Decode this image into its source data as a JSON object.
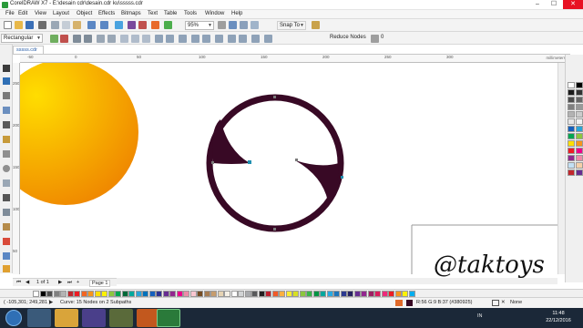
{
  "window": {
    "title": "CorelDRAW X7 - E:\\desain cdr\\desain.cdr ku\\sssss.cdr"
  },
  "menu": [
    "File",
    "Edit",
    "View",
    "Layout",
    "Object",
    "Effects",
    "Bitmaps",
    "Text",
    "Table",
    "Tools",
    "Window",
    "Help"
  ],
  "toolbar": {
    "zoom": "95%",
    "snap_to": "Snap To"
  },
  "property_bar": {
    "selection_mode": "Rectangular",
    "reduce_nodes": "Reduce Nodes",
    "smoothness_value": "0"
  },
  "document": {
    "tab": "sssss.cdr",
    "ruler_units": "millimeters"
  },
  "ruler_h": [
    "-50",
    "0",
    "50",
    "100",
    "150",
    "200",
    "250",
    "300"
  ],
  "ruler_v": [
    "250",
    "200",
    "150",
    "100",
    "50"
  ],
  "pages": {
    "position": "1 of 1",
    "page_tab": "Page 1"
  },
  "status": {
    "coords": "( -105,301; 249,281 )",
    "selection": "Curve: 15 Nodes on 2 Subpaths",
    "fill_info": "R:56 G:9 B:37 (#380925)",
    "outline": "None"
  },
  "taskbar": {
    "lang": "IN",
    "time": "11:48",
    "date": "22/12/2016"
  },
  "watermark": "@taktoys",
  "colors": {
    "shape_fill": "#380925",
    "sphere_inner": "#ffdd00",
    "sphere_outer": "#f08a00",
    "node": "#1f8fb0"
  },
  "palette_right": [
    "#ffffff",
    "#000000",
    "#1a1a1a",
    "#333333",
    "#4d4d4d",
    "#666666",
    "#808080",
    "#999999",
    "#b3b3b3",
    "#cccccc",
    "#e6e6e6",
    "#f2f2f2",
    "#1560bd",
    "#2aa4d8",
    "#00a651",
    "#8dc63f",
    "#ffde00",
    "#f7941d",
    "#ed1c24",
    "#ec008c",
    "#92278f",
    "#ed8aa8",
    "#c2e0f4",
    "#f5d0a9",
    "#c1272d",
    "#662d91"
  ],
  "palette_bottom": [
    "#ffffff",
    "#000000",
    "#4d4d4d",
    "#808080",
    "#b3b3b3",
    "#c1272d",
    "#ed1c24",
    "#f26522",
    "#f7941d",
    "#ffde00",
    "#fff200",
    "#8dc63f",
    "#00a651",
    "#006838",
    "#00a99d",
    "#2aa4d8",
    "#0072bc",
    "#1560bd",
    "#2e3192",
    "#662d91",
    "#92278f",
    "#ec008c",
    "#ed8aa8",
    "#f9c6d0",
    "#754c24",
    "#a67c52",
    "#c69c6d",
    "#e6d3b3",
    "#f5f0e6",
    "#ffffff",
    "#d1d3d4",
    "#a7a9ac",
    "#58595b",
    "#231f20",
    "#be1e2d",
    "#f15a29",
    "#fbb040",
    "#f9ed32",
    "#d7df23",
    "#8cc63f",
    "#39b54a",
    "#009444",
    "#00a79d",
    "#27aae1",
    "#1c75bc",
    "#2b3990",
    "#262262",
    "#662d91",
    "#92278f",
    "#9e1f63",
    "#da1c5c",
    "#ee2a7b",
    "#ed1c24",
    "#f7941d",
    "#fff200",
    "#00aeef"
  ]
}
